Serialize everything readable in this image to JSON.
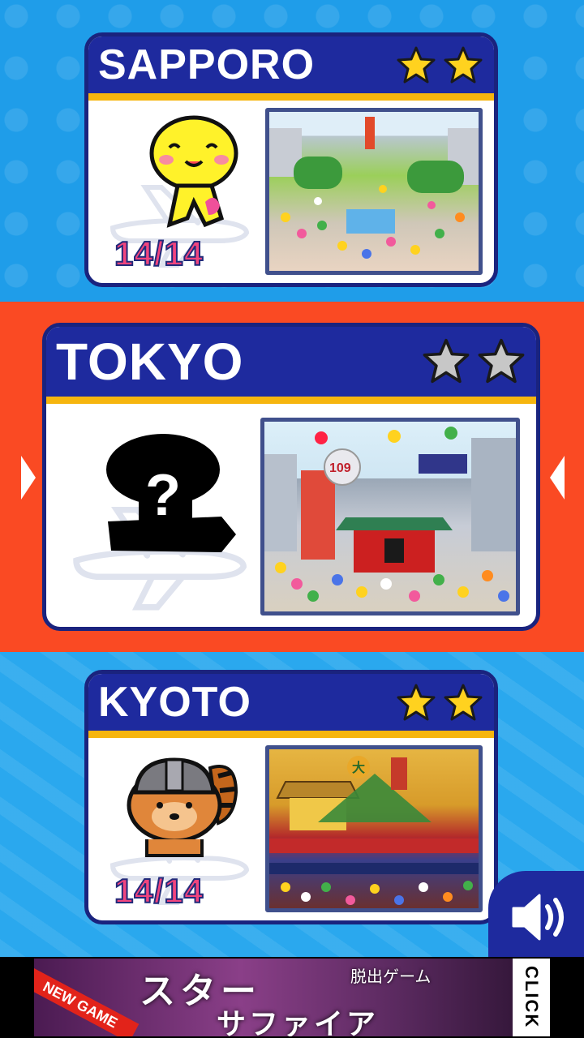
{
  "stages": [
    {
      "name": "SAPPORO",
      "progress": "14/14",
      "stars_earned": 2,
      "stars_total": 2,
      "unlocked": true
    },
    {
      "name": "TOKYO",
      "progress": "",
      "stars_earned": 0,
      "stars_total": 2,
      "unlocked": false,
      "locked_mark": "?"
    },
    {
      "name": "KYOTO",
      "progress": "14/14",
      "stars_earned": 2,
      "stars_total": 2,
      "unlocked": true
    }
  ],
  "scene_labels": {
    "tokyo_building": "109",
    "kyoto_sign": "大"
  },
  "colors": {
    "card_header": "#1e2a9e",
    "card_stripe": "#f6b50e",
    "star_gold": "#ffd21f",
    "star_grey": "#c7c7c7",
    "progress_text": "#f2457e",
    "band_selected": "#fa4a23",
    "band_blue": "#1f9de9"
  },
  "sound_button": {
    "icon": "speaker-icon"
  },
  "ad": {
    "badge": "NEW GAME",
    "title": "スター",
    "subtitle": "サファイア",
    "genre": "脱出ゲーム",
    "cta": "CLICK"
  }
}
